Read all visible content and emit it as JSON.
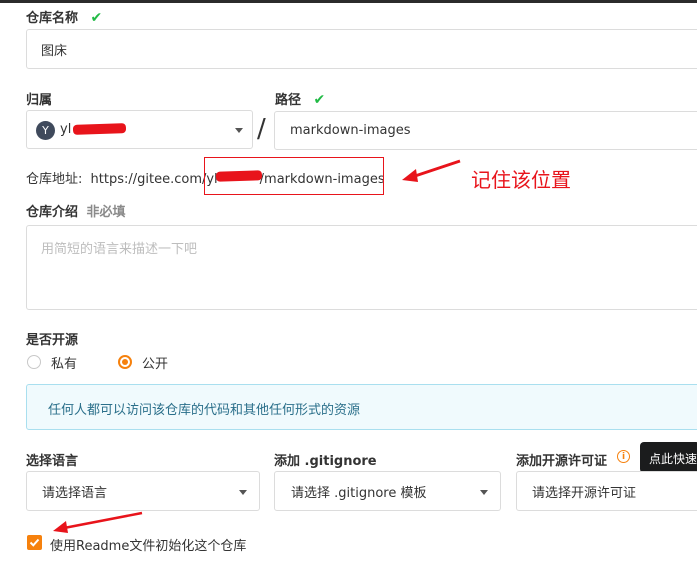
{
  "form": {
    "repo_name": {
      "label": "仓库名称",
      "value": "图床"
    },
    "owner": {
      "label": "归属",
      "avatar_letter": "Y",
      "value": "yl"
    },
    "path": {
      "label": "路径",
      "value": "markdown-images"
    },
    "separator": "/",
    "address": {
      "label": "仓库地址:",
      "prefix": "https://gitee.com/yl",
      "suffix": "/markdown-images"
    },
    "intro": {
      "label": "仓库介绍",
      "optional": "非必填",
      "placeholder": "用简短的语言来描述一下吧"
    },
    "visibility": {
      "label": "是否开源",
      "options": [
        {
          "label": "私有",
          "selected": false
        },
        {
          "label": "公开",
          "selected": true
        }
      ],
      "notice": "任何人都可以访问该仓库的代码和其他任何形式的资源"
    },
    "language": {
      "label": "选择语言",
      "value": "请选择语言"
    },
    "gitignore": {
      "label": "添加 .gitignore",
      "value": "请选择 .gitignore 模板"
    },
    "license": {
      "label": "添加开源许可证",
      "value": "请选择开源许可证",
      "tooltip": "点此快速"
    },
    "readme": {
      "label": "使用Readme文件初始化这个仓库",
      "checked": true
    }
  },
  "annotation": {
    "text": "记住该位置",
    "color": "#e8141b"
  },
  "colors": {
    "accent": "#f6810d",
    "success": "#21ba45",
    "info_border": "#a9dfef",
    "info_bg": "#f0fafd"
  },
  "icons": [
    "checkmark-icon",
    "chevron-down-icon",
    "info-circle-icon",
    "arrow-annotation-icon"
  ]
}
